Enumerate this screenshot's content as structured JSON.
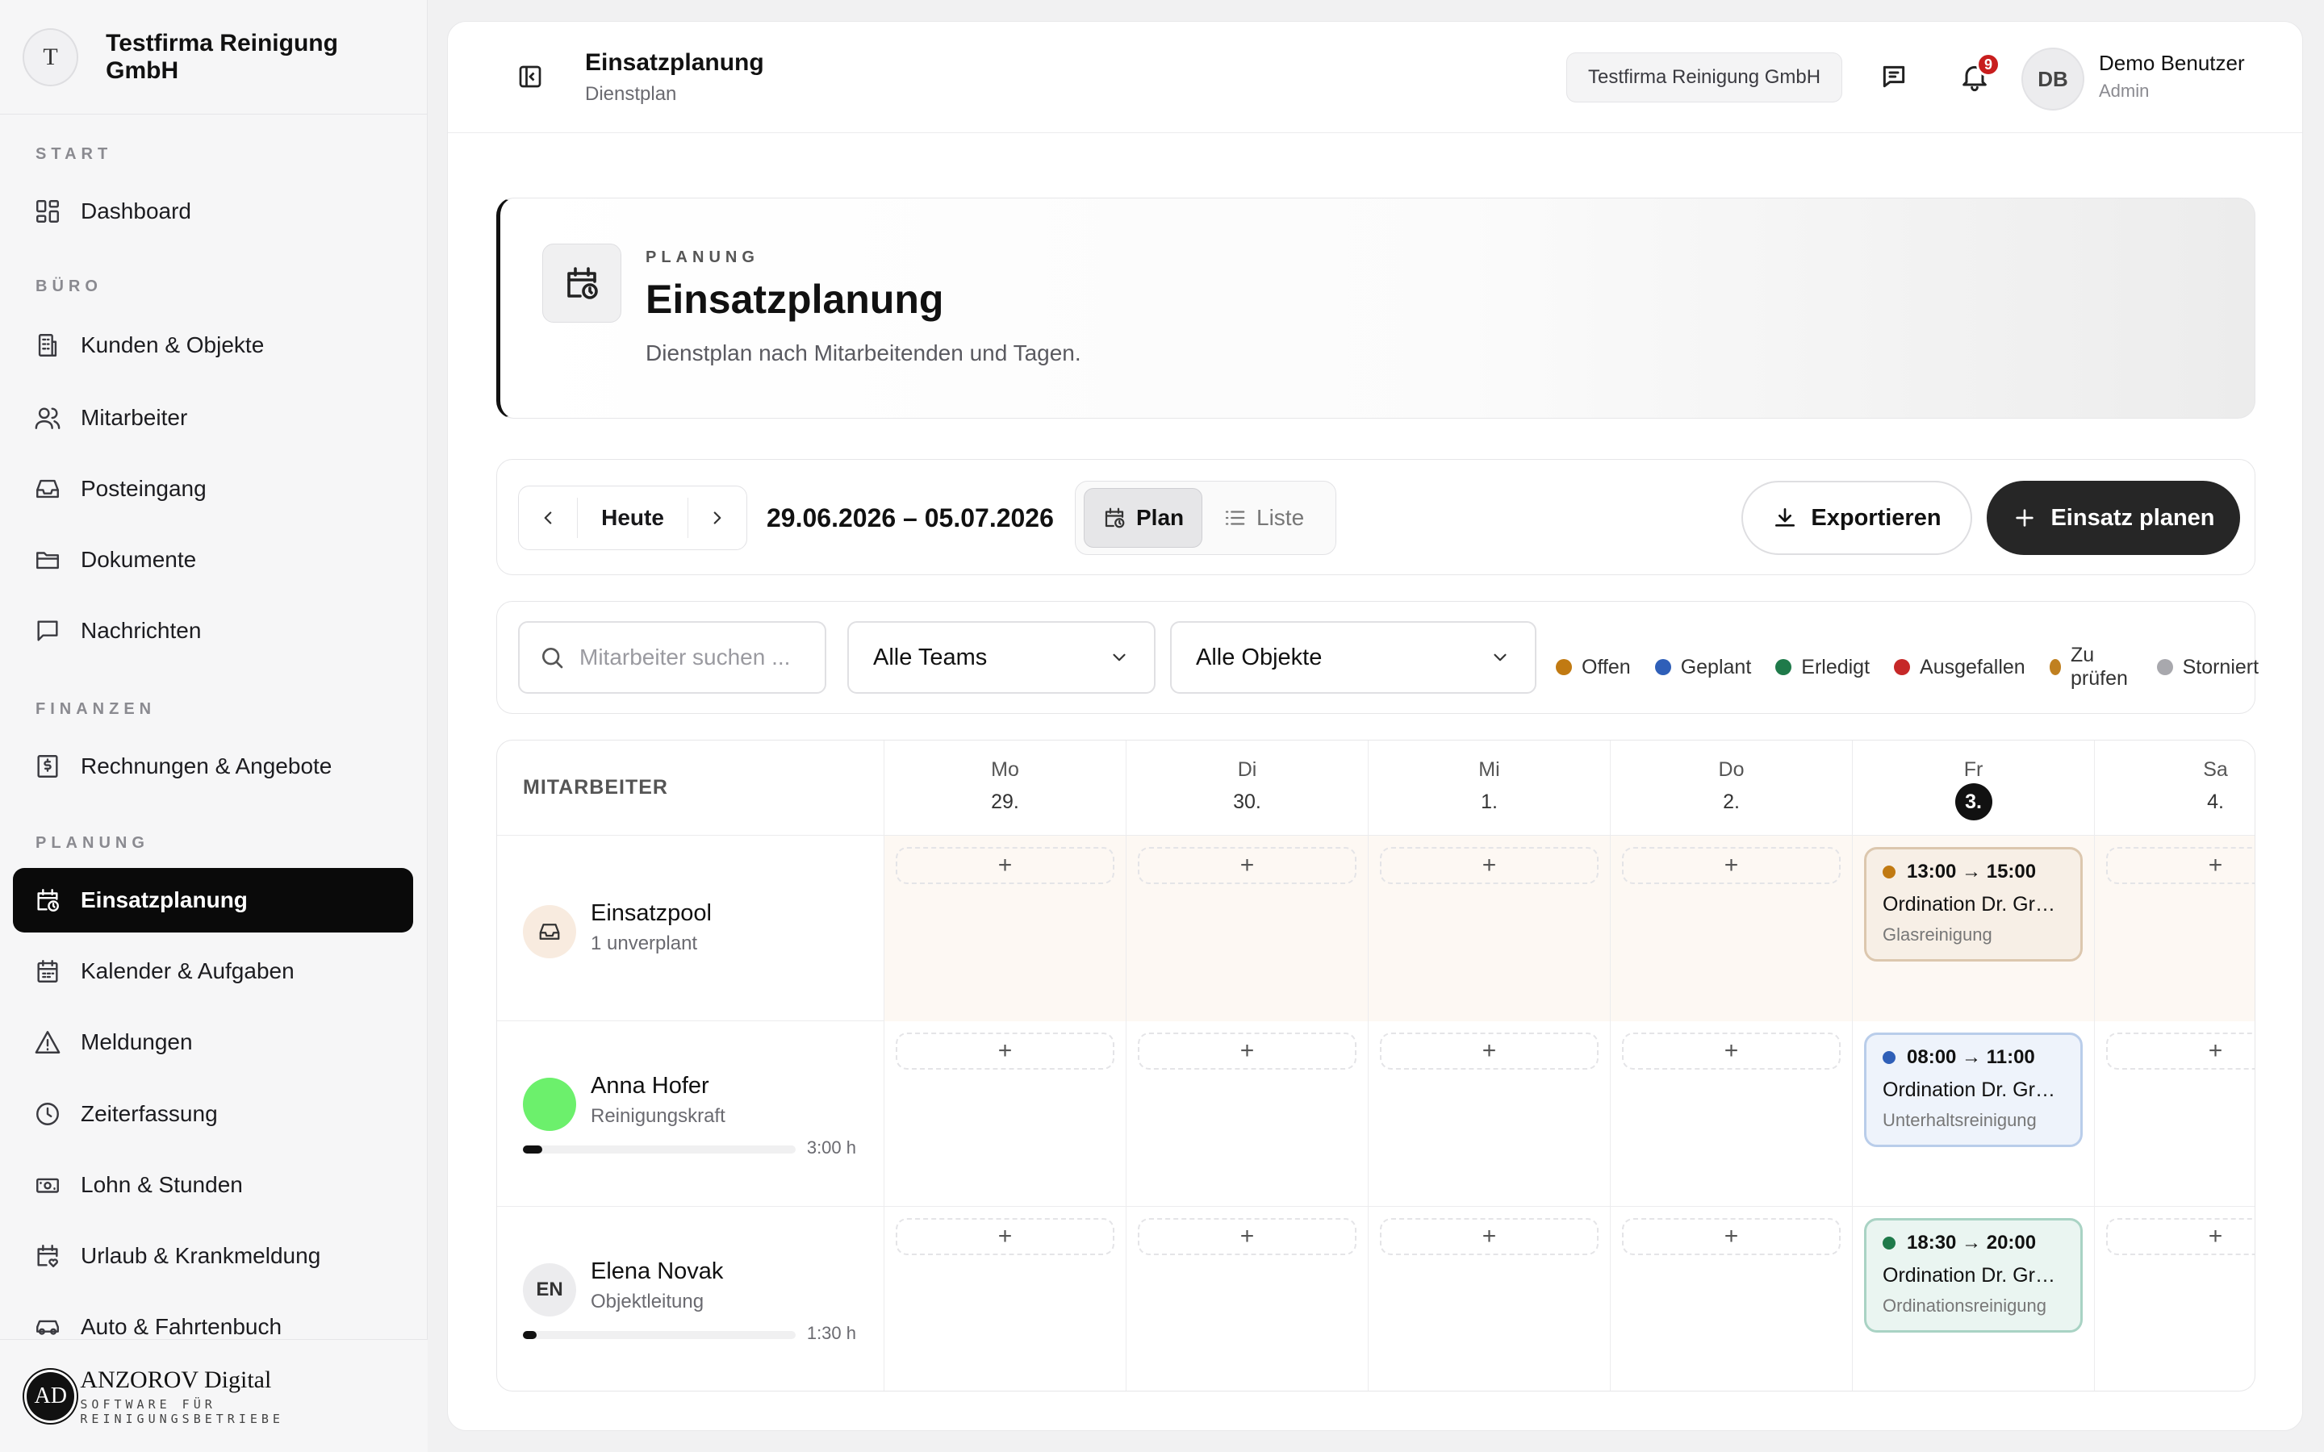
{
  "sidebar": {
    "avatar_letter": "T",
    "company": "Testfirma Reinigung GmbH",
    "sections": {
      "start": "START",
      "buero": "BÜRO",
      "finanzen": "FINANZEN",
      "planung": "PLANUNG"
    },
    "items": [
      {
        "label": "Dashboard",
        "icon": "dashboard-icon"
      },
      {
        "label": "Kunden & Objekte",
        "icon": "building-icon"
      },
      {
        "label": "Mitarbeiter",
        "icon": "users-icon"
      },
      {
        "label": "Posteingang",
        "icon": "inbox-icon"
      },
      {
        "label": "Dokumente",
        "icon": "folder-icon"
      },
      {
        "label": "Nachrichten",
        "icon": "message-icon"
      },
      {
        "label": "Rechnungen & Angebote",
        "icon": "invoice-icon"
      },
      {
        "label": "Einsatzplanung",
        "icon": "calendar-clock-icon",
        "active": true
      },
      {
        "label": "Kalender & Aufgaben",
        "icon": "calendar-icon"
      },
      {
        "label": "Meldungen",
        "icon": "warning-icon"
      },
      {
        "label": "Zeiterfassung",
        "icon": "clock-icon"
      },
      {
        "label": "Lohn & Stunden",
        "icon": "money-icon"
      },
      {
        "label": "Urlaub & Krankmeldung",
        "icon": "calendar-heart-icon"
      },
      {
        "label": "Auto & Fahrtenbuch",
        "icon": "car-icon"
      }
    ],
    "footer": {
      "logo_letters": "AD",
      "brand": "ANZOROV Digital",
      "tagline": "SOFTWARE FÜR REINIGUNGSBETRIEBE"
    }
  },
  "topbar": {
    "title": "Einsatzplanung",
    "subtitle": "Dienstplan",
    "company_chip": "Testfirma Reinigung GmbH",
    "notification_count": "9",
    "user_initials": "DB",
    "user_name": "Demo Benutzer",
    "user_role": "Admin"
  },
  "hero": {
    "eyebrow": "PLANUNG",
    "title": "Einsatzplanung",
    "description": "Dienstplan nach Mitarbeitenden und Tagen."
  },
  "toolbar": {
    "today_label": "Heute",
    "date_range": "29.06.2026 – 05.07.2026",
    "view_plan": "Plan",
    "view_list": "Liste",
    "export_label": "Exportieren",
    "plan_label": "Einsatz planen"
  },
  "filters": {
    "search_placeholder": "Mitarbeiter suchen ...",
    "teams_selected": "Alle Teams",
    "objects_selected": "Alle Objekte",
    "legend": [
      {
        "label": "Offen",
        "color": "#c17a12"
      },
      {
        "label": "Geplant",
        "color": "#2f5fb8"
      },
      {
        "label": "Erledigt",
        "color": "#1f7a4a"
      },
      {
        "label": "Ausgefallen",
        "color": "#c62828"
      },
      {
        "label": "Zu prüfen",
        "color": "#c08020"
      },
      {
        "label": "Storniert",
        "color": "#a8a8ad"
      }
    ]
  },
  "grid": {
    "header_label": "MITARBEITER",
    "days": [
      {
        "name": "Mo",
        "num": "29."
      },
      {
        "name": "Di",
        "num": "30."
      },
      {
        "name": "Mi",
        "num": "1."
      },
      {
        "name": "Do",
        "num": "2."
      },
      {
        "name": "Fr",
        "num": "3.",
        "today": true
      },
      {
        "name": "Sa",
        "num": "4."
      }
    ],
    "add_symbol": "+",
    "rows": [
      {
        "name": "Einsatzpool",
        "role": "1 unverplant",
        "avatar": "inbox",
        "shift": {
          "time": "13:00 → 15:00",
          "object": "Ordination Dr. Grub...",
          "type": "Glasreinigung",
          "status_color": "#c17a12",
          "bg": "#f7efe6",
          "border": "#dcc7ae"
        }
      },
      {
        "name": "Anna Hofer",
        "role": "Reinigungskraft",
        "avatar_color": "#6cf06c",
        "hours": "3:00 h",
        "hours_fraction": 0.07,
        "shift": {
          "time": "08:00 → 11:00",
          "object": "Ordination Dr. Grub...",
          "type": "Unterhaltsreinigung",
          "status_color": "#2f5fb8",
          "bg": "#eef3fb",
          "border": "#b9cdea"
        }
      },
      {
        "name": "Elena Novak",
        "role": "Objektleitung",
        "initials": "EN",
        "hours": "1:30 h",
        "hours_fraction": 0.05,
        "shift": {
          "time": "18:30 → 20:00",
          "object": "Ordination Dr. Grub...",
          "type": "Ordinationsreinigung",
          "status_color": "#1f7a4a",
          "bg": "#eaf5f1",
          "border": "#a9d3c4"
        }
      }
    ]
  }
}
